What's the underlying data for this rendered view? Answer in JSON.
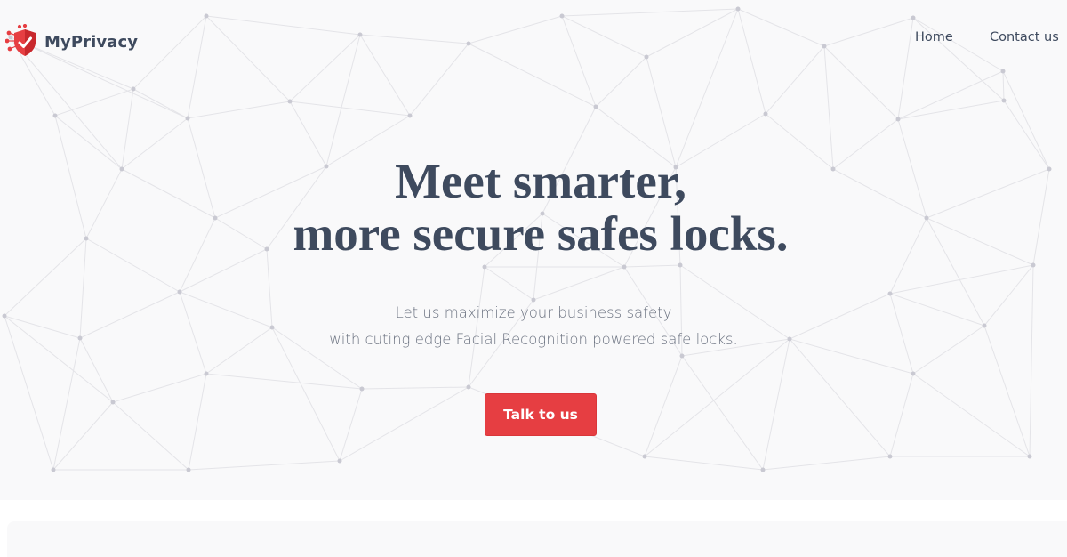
{
  "brand": {
    "name": "MyPrivacy",
    "accent": "#e63e42",
    "text_color": "#3e4a5e",
    "logo_icon": "shield-check-icon"
  },
  "nav": {
    "items": [
      {
        "label": "Home"
      },
      {
        "label": "Contact us"
      }
    ]
  },
  "hero": {
    "headline_line1": "Meet smarter,",
    "headline_line2": "more secure safes locks.",
    "subtext_line1": "Let us maximize your business safety",
    "subtext_line2": "with cuting edge Facial Recognition powered safe locks.",
    "cta_label": "Talk to us",
    "background_pattern": "network-mesh"
  }
}
